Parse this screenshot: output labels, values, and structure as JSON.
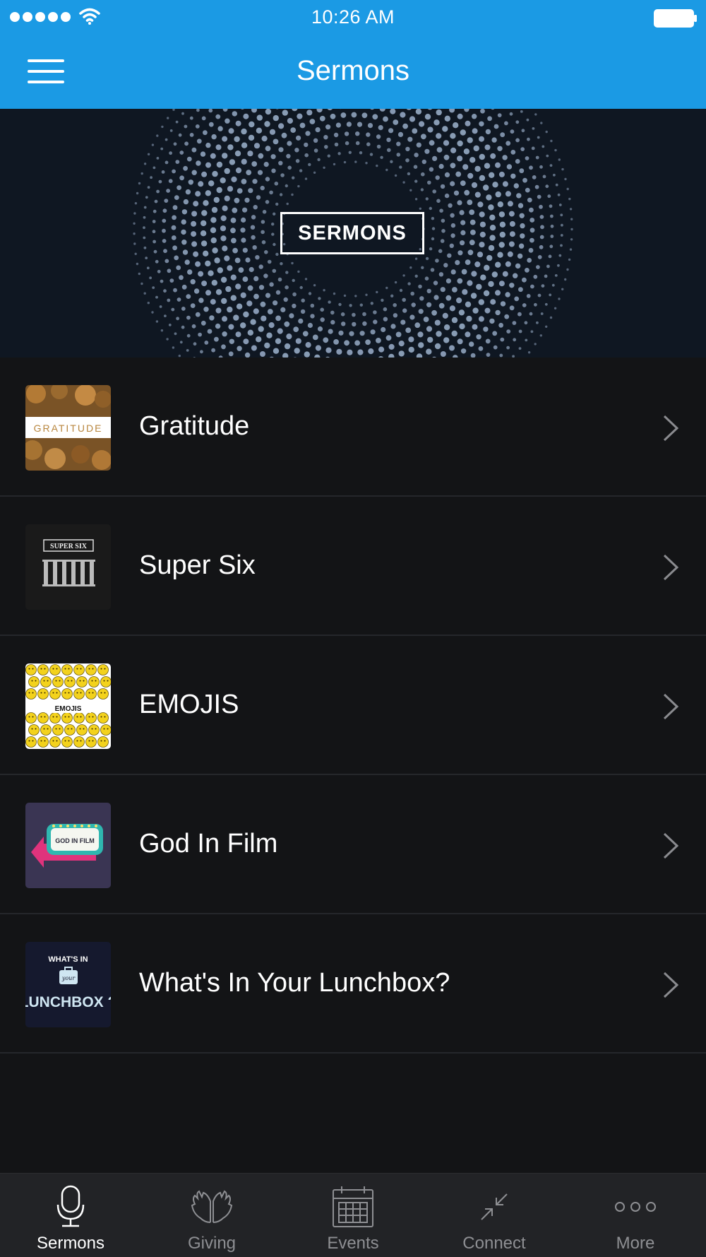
{
  "status_bar": {
    "time": "10:26 AM",
    "signal_icon": "signal-dots-icon",
    "wifi_icon": "wifi-icon",
    "battery_icon": "battery-icon"
  },
  "nav": {
    "title": "Sermons",
    "menu_icon": "hamburger-menu-icon"
  },
  "hero": {
    "badge_text": "SERMONS"
  },
  "series": [
    {
      "title": "Gratitude",
      "thumb_text": "GRATITUDE"
    },
    {
      "title": "Super Six",
      "thumb_text": "SUPER SIX"
    },
    {
      "title": "EMOJIS",
      "thumb_text": "EMOJIS"
    },
    {
      "title": "God In Film",
      "thumb_text": "GOD IN FILM"
    },
    {
      "title": "What's In Your Lunchbox?",
      "thumb_text_top": "WHAT'S IN",
      "thumb_text_mid": "your",
      "thumb_text_bottom": "LUNCHBOX ?"
    }
  ],
  "tabs": [
    {
      "label": "Sermons",
      "icon": "microphone-icon",
      "active": true
    },
    {
      "label": "Giving",
      "icon": "praying-hands-icon",
      "active": false
    },
    {
      "label": "Events",
      "icon": "calendar-icon",
      "active": false
    },
    {
      "label": "Connect",
      "icon": "arrows-connect-icon",
      "active": false
    },
    {
      "label": "More",
      "icon": "more-dots-icon",
      "active": false
    }
  ],
  "colors": {
    "primary": "#1b9ae4",
    "background": "#131416",
    "tab_bar": "#222326",
    "active_tab": "#ffffff",
    "inactive_tab": "#8e8f93"
  }
}
